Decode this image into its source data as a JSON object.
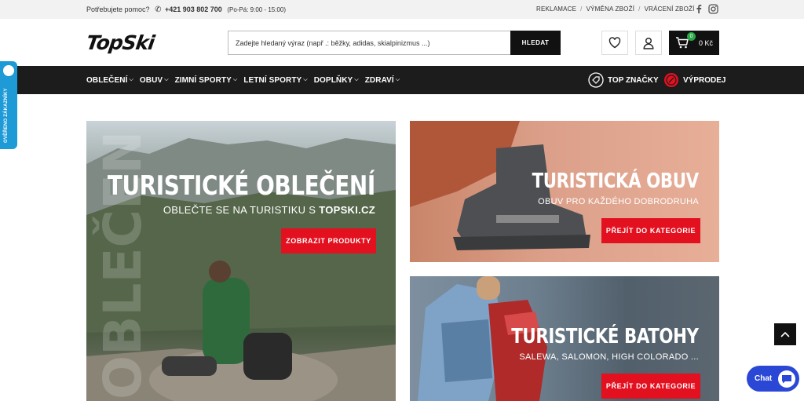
{
  "topbar": {
    "help_text": "Potřebujete pomoc?",
    "phone": "+421 903 802 700",
    "hours": "(Po-Pá: 9:00 - 15:00)",
    "links": [
      "REKLAMACE",
      "VÝMĚNA ZBOŽÍ",
      "VRÁCENÍ ZBOŽÍ"
    ]
  },
  "header": {
    "logo_text": "TopSki",
    "search_placeholder": "Zadejte hledaný výraz (např .: běžky, adidas, skialpinizmus ...)",
    "search_button": "HLEDAT",
    "cart_count": "0",
    "cart_total": "0 Kč"
  },
  "nav": {
    "items": [
      "OBLEČENÍ",
      "OBUV",
      "ZIMNÍ SPORTY",
      "LETNÍ SPORTY",
      "DOPLŇKY",
      "ZDRAVÍ"
    ],
    "top_brands": "TOP ZNAČKY",
    "sale": "VÝPRODEJ"
  },
  "side_widget": {
    "label": "OVĚŘENO ZÁKAZNÍKY"
  },
  "banners": {
    "clothing": {
      "title": "TURISTICKÉ OBLEČENÍ",
      "subtitle_prefix": "OBLEČTE SE NA TURISTIKU S",
      "subtitle_brand": "TOPSKI.CZ",
      "button": "ZOBRAZIT PRODUKTY",
      "ghost_text": "OBLEČEN"
    },
    "shoes": {
      "title": "TURISTICKÁ OBUV",
      "subtitle": "OBUV PRO KAŽDÉHO DOBRODRUHA",
      "button": "PŘEJÍT DO KATEGORIE"
    },
    "backpacks": {
      "title": "TURISTICKÉ BATOHY",
      "subtitle": "SALEWA, SALOMON, HIGH COLORADO ...",
      "button": "PŘEJÍT DO KATEGORIE"
    }
  },
  "chat": {
    "label": "Chat"
  },
  "colors": {
    "accent_red": "#e3101f",
    "nav_bg": "#1c1c1c",
    "chat_blue": "#2b47d6",
    "widget_blue": "#1e9ad6"
  }
}
